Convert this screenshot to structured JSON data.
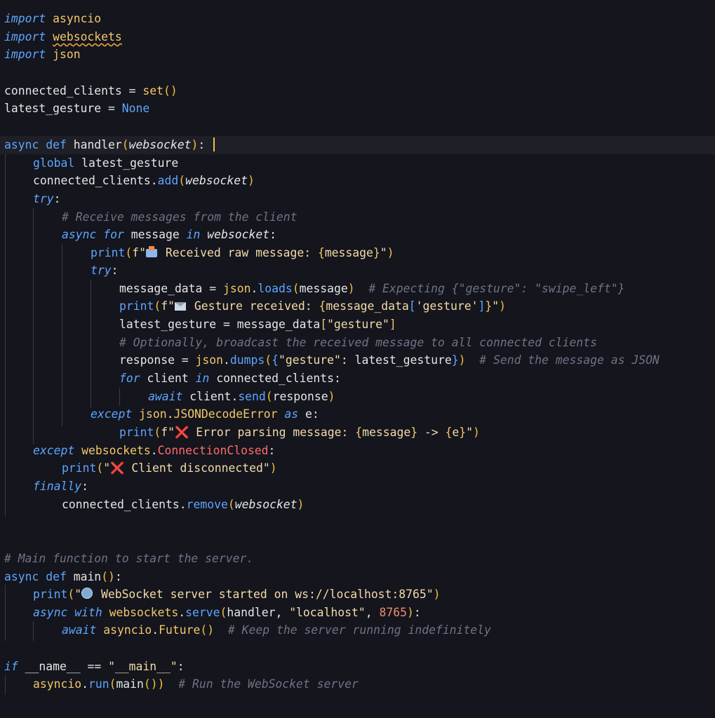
{
  "lines": {
    "l1": {
      "kw": "import",
      "mod": "asyncio"
    },
    "l2": {
      "kw": "import",
      "mod": "websockets"
    },
    "l3": {
      "kw": "import",
      "mod": "json"
    },
    "l5": {
      "var": "connected_clients",
      "op": " = ",
      "fn": "set",
      "paren": "()"
    },
    "l6": {
      "var": "latest_gesture",
      "op": " = ",
      "val": "None"
    },
    "l8": {
      "kw1": "async",
      "kw2": "def",
      "fn": "handler",
      "param": "websocket",
      "tail": ":"
    },
    "l9": {
      "kw": "global",
      "var": "latest_gesture"
    },
    "l10": {
      "obj": "connected_clients",
      "dot": ".",
      "meth": "add",
      "param": "websocket"
    },
    "l11": {
      "kw": "try",
      "tail": ":"
    },
    "l12": {
      "comment": "# Receive messages from the client"
    },
    "l13": {
      "kw1": "async",
      "kw2": "for",
      "var": "message",
      "kw3": "in",
      "param": "websocket",
      "tail": ":"
    },
    "l14": {
      "fn": "print",
      "pre": "f\"",
      "text": " Received raw message: ",
      "expr": "message",
      "post": "\""
    },
    "l15": {
      "kw": "try",
      "tail": ":"
    },
    "l16": {
      "var": "message_data",
      "op": " = ",
      "mod": "json",
      "meth": "loads",
      "arg": "message",
      "comment": "# Expecting {\"gesture\": \"swipe_left\"}"
    },
    "l17": {
      "fn": "print",
      "pre": "f\"",
      "text": " Gesture received: ",
      "expr1": "message_data",
      "expr2": "'gesture'",
      "post": "\""
    },
    "l18": {
      "var": "latest_gesture",
      "op": " = ",
      "obj": "message_data",
      "key": "\"gesture\""
    },
    "l19": {
      "comment": "# Optionally, broadcast the received message to all connected clients"
    },
    "l20": {
      "var": "response",
      "op": " = ",
      "mod": "json",
      "meth": "dumps",
      "key": "\"gesture\"",
      "val": "latest_gesture",
      "comment": "# Send the message as JSON"
    },
    "l21": {
      "kw1": "for",
      "var": "client",
      "kw2": "in",
      "obj": "connected_clients",
      "tail": ":"
    },
    "l22": {
      "kw": "await",
      "obj": "client",
      "meth": "send",
      "arg": "response"
    },
    "l23": {
      "kw": "except",
      "mod": "json",
      "cls": "JSONDecodeError",
      "kw2": "as",
      "var": "e",
      "tail": ":"
    },
    "l24": {
      "fn": "print",
      "pre": "f\"",
      "emoji": "❌",
      "text": " Error parsing message: ",
      "expr1": "message",
      "arrow": " -> ",
      "expr2": "e",
      "post": "\""
    },
    "l25": {
      "kw": "except",
      "mod": "websockets",
      "cls": "ConnectionClosed",
      "tail": ":"
    },
    "l26": {
      "fn": "print",
      "str1": "\"",
      "emoji": "❌",
      "str2": " Client disconnected\""
    },
    "l27": {
      "kw": "finally",
      "tail": ":"
    },
    "l28": {
      "obj": "connected_clients",
      "meth": "remove",
      "param": "websocket"
    },
    "l31": {
      "comment": "# Main function to start the server."
    },
    "l32": {
      "kw1": "async",
      "kw2": "def",
      "fn": "main",
      "tail": ":"
    },
    "l33": {
      "fn": "print",
      "str1": "\"",
      "str2": " WebSocket server started on ws://localhost:8765\""
    },
    "l34": {
      "kw1": "async",
      "kw2": "with",
      "mod": "websockets",
      "meth": "serve",
      "arg1": "handler",
      "arg2": "\"localhost\"",
      "num": "8765",
      "tail": ":"
    },
    "l35": {
      "kw": "await",
      "mod": "asyncio",
      "meth": "Future",
      "comment": "# Keep the server running indefinitely"
    },
    "l37": {
      "kw": "if",
      "var": "__name__",
      "op": " == ",
      "str": "\"__main__\"",
      "tail": ":"
    },
    "l38": {
      "mod": "asyncio",
      "meth": "run",
      "arg": "main",
      "comment": "# Run the WebSocket server"
    }
  }
}
